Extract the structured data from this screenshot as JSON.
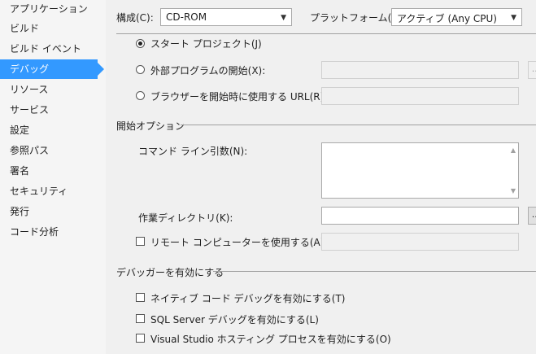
{
  "sidebar": {
    "items": [
      {
        "label": "アプリケーション"
      },
      {
        "label": "ビルド"
      },
      {
        "label": "ビルド イベント"
      },
      {
        "label": "デバッグ"
      },
      {
        "label": "リソース"
      },
      {
        "label": "サービス"
      },
      {
        "label": "設定"
      },
      {
        "label": "参照パス"
      },
      {
        "label": "署名"
      },
      {
        "label": "セキュリティ"
      },
      {
        "label": "発行"
      },
      {
        "label": "コード分析"
      }
    ],
    "active_index": 3
  },
  "header": {
    "config_label": "構成(C):",
    "config_value": "CD-ROM",
    "platform_label": "プラットフォーム(M):",
    "platform_value": "アクティブ (Any CPU)"
  },
  "start_action": {
    "start_project_label": "スタート プロジェクト(J)",
    "external_program_label": "外部プログラムの開始(X):",
    "external_program_value": "",
    "browser_url_label": "ブラウザーを開始時に使用する URL(R):",
    "browser_url_value": "",
    "browse_button_label": "..."
  },
  "start_options": {
    "section_title": "開始オプション",
    "cmd_args_label": "コマンド ライン引数(N):",
    "cmd_args_value": "",
    "work_dir_label": "作業ディレクトリ(K):",
    "work_dir_value": "",
    "remote_label": "リモート コンピューターを使用する(A)",
    "remote_value": "",
    "browse_button_label": "..."
  },
  "debuggers": {
    "section_title": "デバッガーを有効にする",
    "native_label": "ネイティブ コード デバッグを有効にする(T)",
    "sql_label": "SQL Server デバッグを有効にする(L)",
    "vs_hosting_label": "Visual Studio ホスティング プロセスを有効にする(O)"
  },
  "colors": {
    "active_item": "#3399ff",
    "background": "#f0f0f0"
  }
}
